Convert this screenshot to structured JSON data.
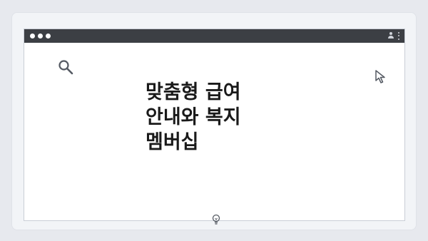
{
  "headline": {
    "line1": "맞춤형 급여",
    "line2": "안내와 복지",
    "line3": "멤버십"
  },
  "icons": {
    "search": "search-icon",
    "cursor": "cursor-arrow-icon",
    "bulb": "lightbulb-icon",
    "user": "user-icon",
    "menu": "kebab-menu-icon"
  },
  "colors": {
    "page_background": "#e7e9ee",
    "titlebar": "#3c3f44",
    "text": "#1a1a1a",
    "icon_stroke": "#555a63"
  }
}
